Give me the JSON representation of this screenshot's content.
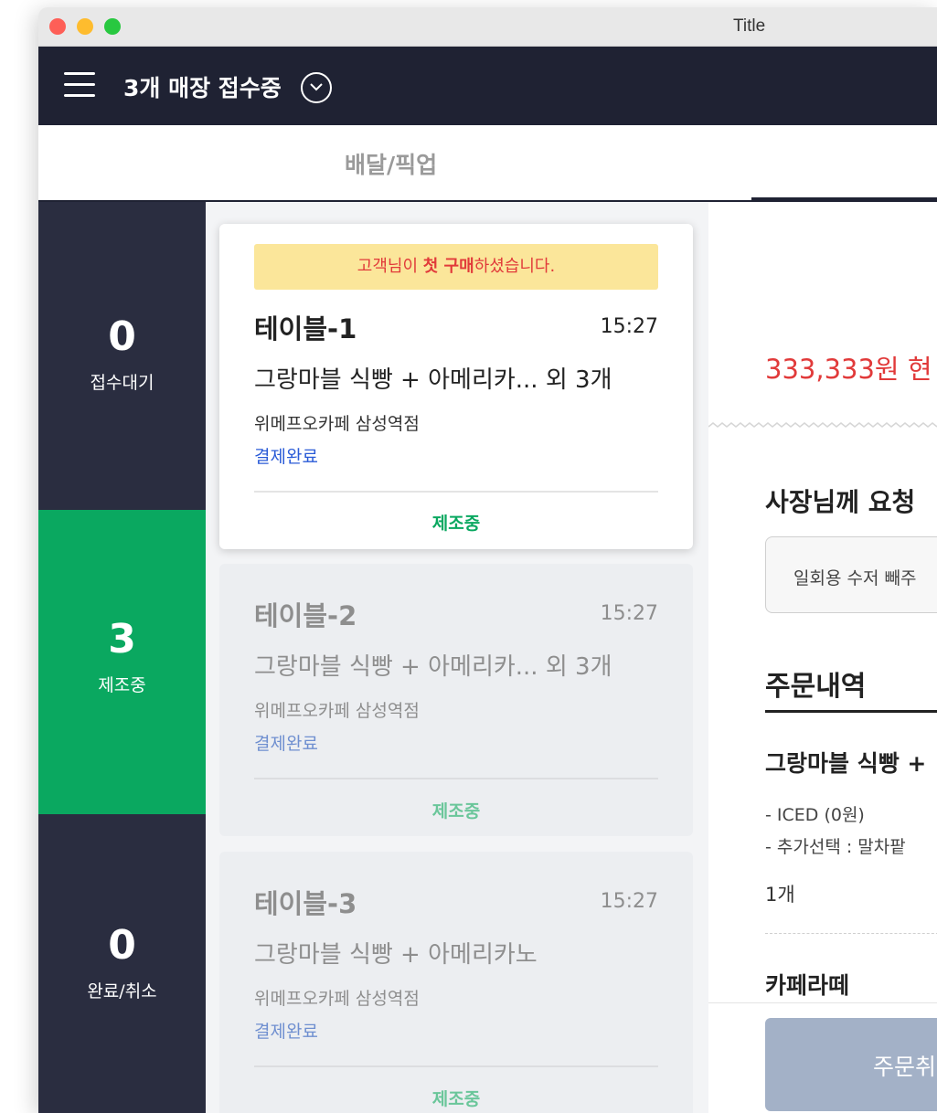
{
  "window": {
    "title": "Title"
  },
  "topbar": {
    "store_status": "3개 매장 접수중"
  },
  "tabs": {
    "delivery_pickup": "배달/픽업"
  },
  "sidebar": {
    "waiting": {
      "count": "0",
      "label": "접수대기"
    },
    "making": {
      "count": "3",
      "label": "제조중"
    },
    "done": {
      "count": "0",
      "label": "완료/취소"
    }
  },
  "orders": [
    {
      "notice_prefix": "고객님이 ",
      "notice_emphasis": "첫 구매",
      "notice_suffix": "하셨습니다.",
      "table": "테이블-1",
      "time": "15:27",
      "items": "그랑마블 식빵 + 아메리카... 외 3개",
      "store": "위메프오카페 삼성역점",
      "payment": "결제완료",
      "status": "제조중"
    },
    {
      "table": "테이블-2",
      "time": "15:27",
      "items": "그랑마블 식빵 + 아메리카... 외 3개",
      "store": "위메프오카페 삼성역점",
      "payment": "결제완료",
      "status": "제조중"
    },
    {
      "table": "테이블-3",
      "time": "15:27",
      "items": "그랑마블 식빵 + 아메리카노",
      "store": "위메프오카페 삼성역점",
      "payment": "결제완료",
      "status": "제조중"
    }
  ],
  "detail": {
    "amount": "333,333원 현",
    "request_title": "사장님께 요청",
    "request_text": "일회용 수저 빼주",
    "order_list_title": "주문내역",
    "item1": {
      "name": "그랑마블 식빵 +",
      "options": [
        "- ICED (0원)",
        "- 추가선택 : 말차팥"
      ],
      "qty": "1개"
    },
    "item2": {
      "name": "카페라떼"
    },
    "cancel_button": "주문취"
  },
  "colors": {
    "navy": "#1f2233",
    "green": "#0aa860",
    "red": "#e13a3a",
    "blue": "#2a5bd7",
    "notice_bg": "#fbe69a"
  }
}
